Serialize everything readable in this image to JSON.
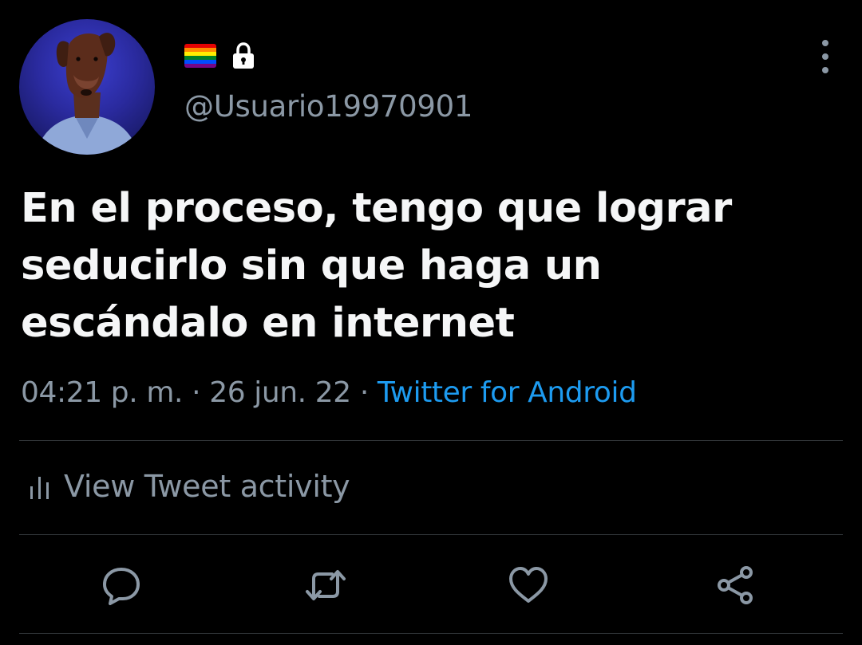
{
  "user": {
    "handle": "@Usuario19970901",
    "avatar": "avatar",
    "badges": [
      "rainbow-flag-icon",
      "lock-icon"
    ]
  },
  "tweet": {
    "text": "En el proceso, tengo que lograr seducirlo sin que haga un escándalo en internet",
    "time": "04:21 p. m.",
    "separator": " · ",
    "date": "26 jun. 22",
    "source": "Twitter for Android"
  },
  "activity": {
    "icon": "bar-chart-icon",
    "label": "View Tweet activity"
  },
  "actions": [
    "reply-icon",
    "retweet-icon",
    "like-icon",
    "share-icon"
  ],
  "colors": {
    "background": "#000000",
    "text": "#f5f6f7",
    "muted": "#8b98a5",
    "link": "#1d9bf0",
    "divider": "#2f3336"
  }
}
